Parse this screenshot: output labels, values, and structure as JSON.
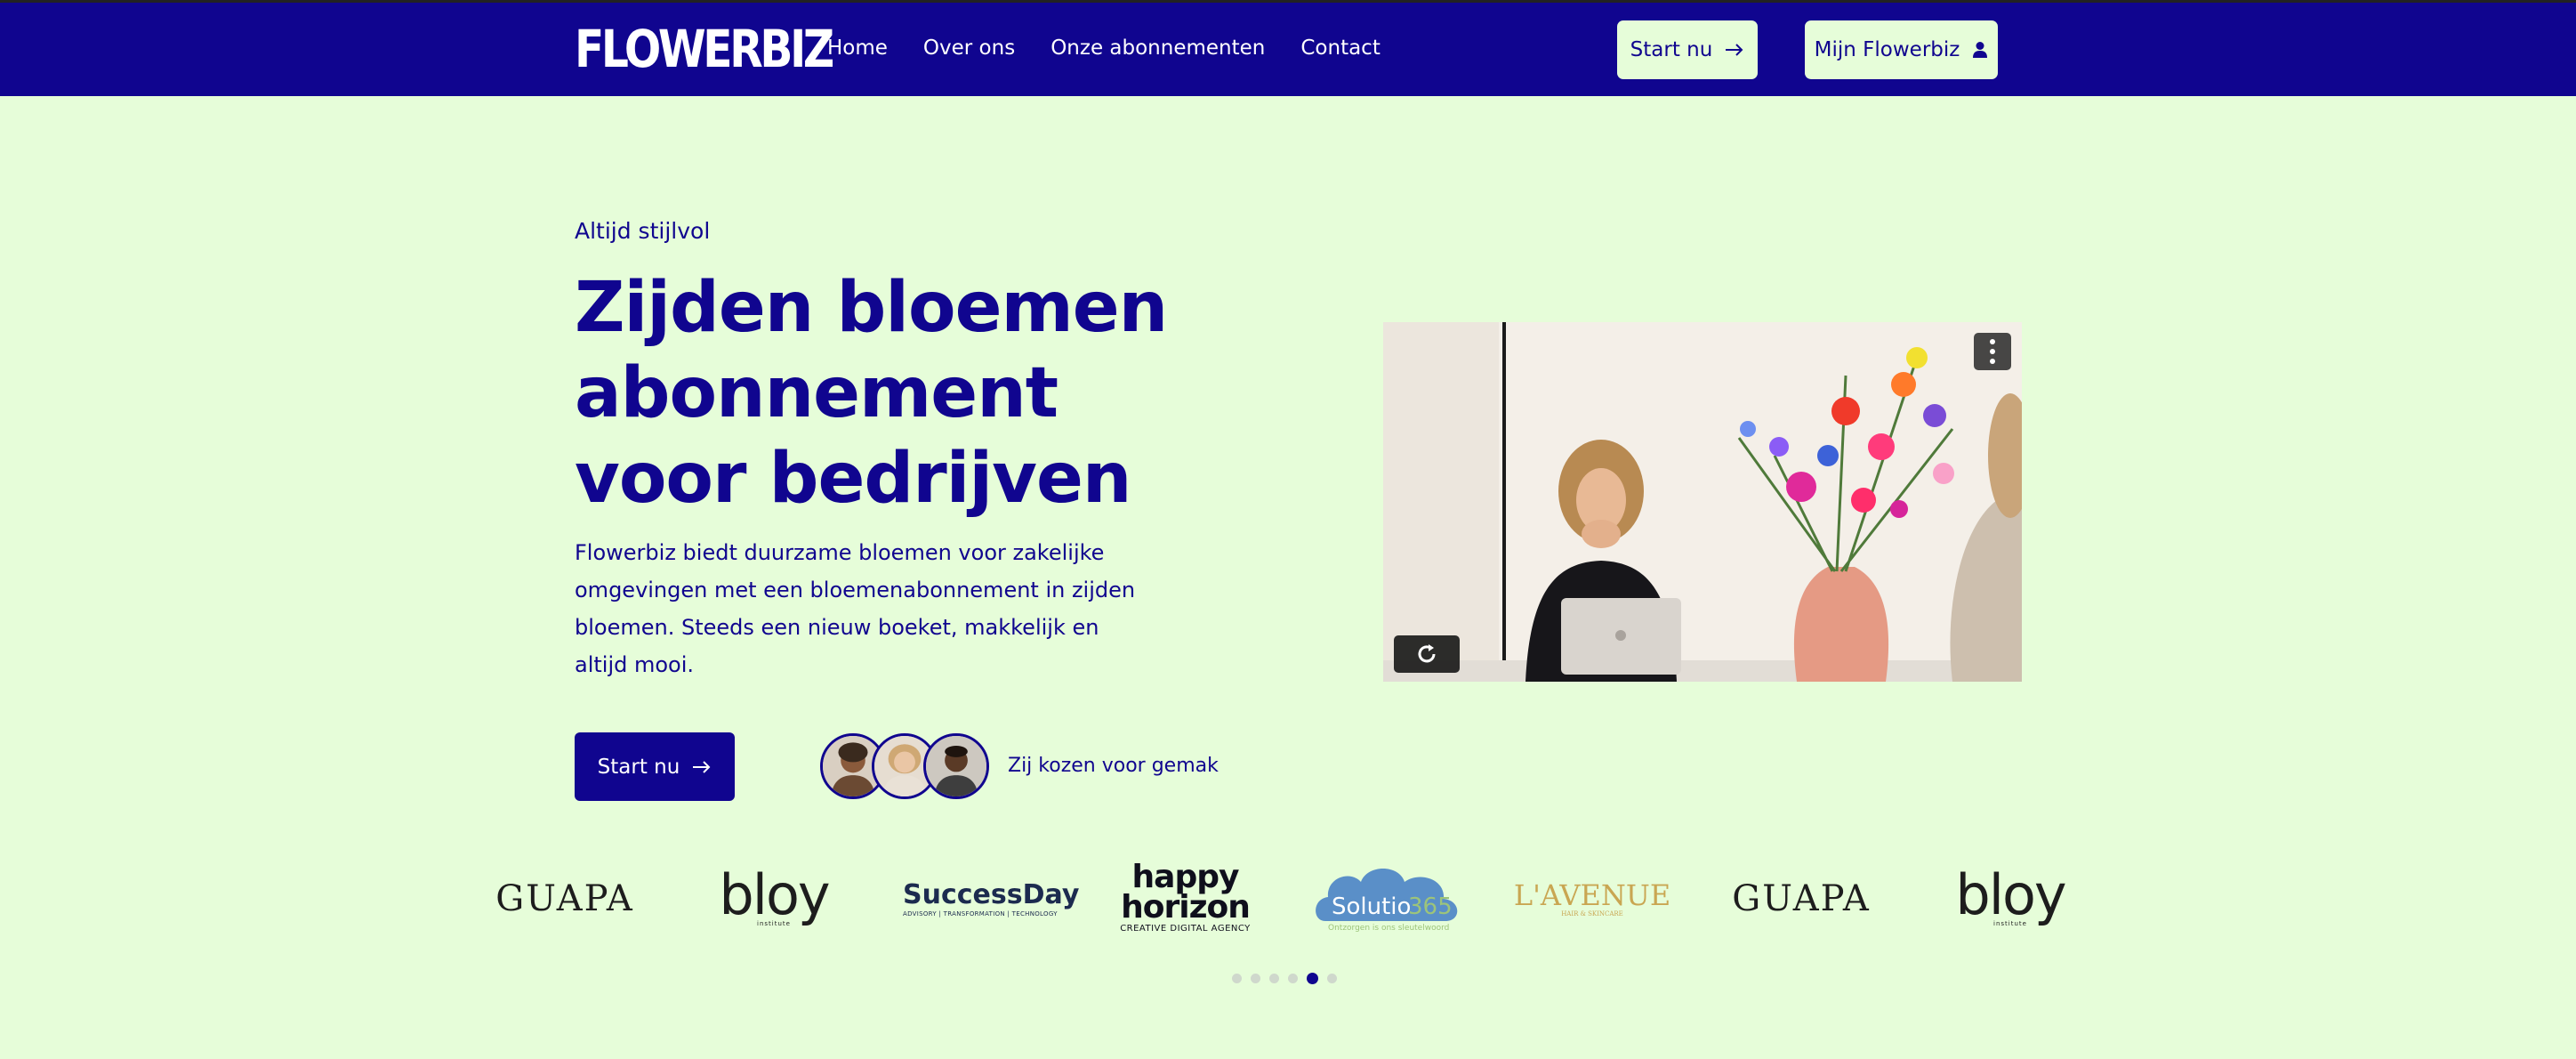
{
  "nav": {
    "logo": "FLOWERBIZ",
    "links": [
      "Home",
      "Over ons",
      "Onze abonnementen",
      "Contact"
    ],
    "start_label": "Start nu",
    "account_label": "Mijn Flowerbiz"
  },
  "hero": {
    "eyebrow": "Altijd stijlvol",
    "title": "Zijden bloemen abonnement voor bedrijven",
    "description": "Flowerbiz biedt duurzame bloemen voor zakelijke omgevingen met een bloemenabonnement in zijden bloemen. Steeds een nieuw boeket, makkelijk en altijd mooi.",
    "cta_label": "Start nu",
    "social_proof": "Zij kozen voor gemak"
  },
  "logos": {
    "guapa": "GUAPA",
    "bloy": "bloy",
    "bloy_sub": "institute",
    "successday": "SuccessDay",
    "successday_sub": "ADVISORY | TRANSFORMATION | TECHNOLOGY",
    "happy_line1": "happy",
    "happy_line2": "horizon",
    "happy_sub": "CREATIVE DIGITAL AGENCY",
    "solutio": "Solutio",
    "solutio_num": "365",
    "solutio_sub": "Ontzorgen is ons sleutelwoord",
    "avenue": "L'AVENUE",
    "avenue_sub": "HAIR & SKINCARE"
  },
  "carousel": {
    "count": 6,
    "active_index": 4
  },
  "colors": {
    "brand": "#10058f",
    "background": "#e6fdd9",
    "white": "#ffffff"
  }
}
